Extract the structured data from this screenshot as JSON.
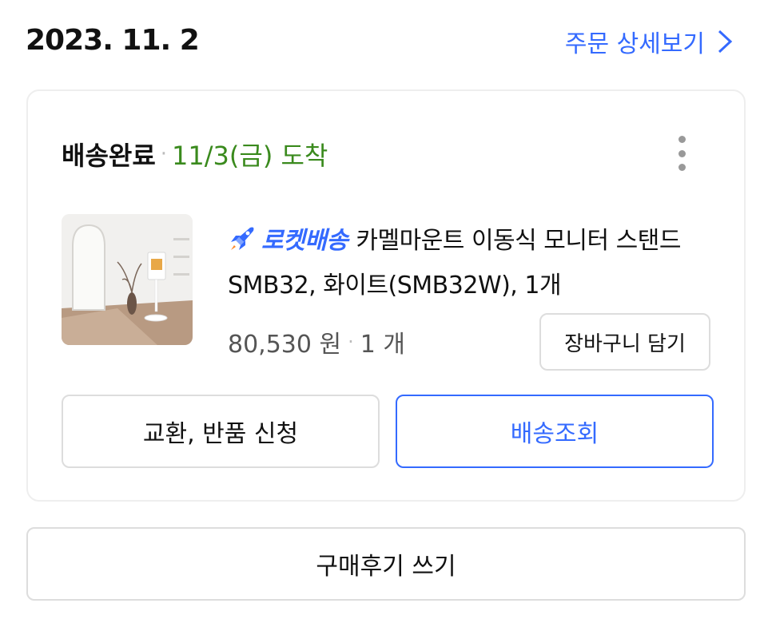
{
  "order": {
    "date": "2023. 11. 2",
    "detail_link_label": "주문 상세보기"
  },
  "shipment": {
    "status": "배송완료",
    "separator": "·",
    "arrival": "11/3(금) 도착"
  },
  "product": {
    "badge": "로켓배송",
    "name": "카멜마운트 이동식 모니터 스탠드 SMB32, 화이트(SMB32W), 1개",
    "price": "80,530 원",
    "quantity": "1 개",
    "cart_button": "장바구니 담기"
  },
  "actions": {
    "return_button": "교환, 반품 신청",
    "track_button": "배송조회",
    "review_button": "구매후기 쓰기"
  },
  "colors": {
    "accent": "#346aff",
    "delivered_green": "#3a8a1d",
    "border": "#dddddd"
  },
  "icons": [
    "chevron-right-icon",
    "more-vertical-icon",
    "rocket-icon"
  ]
}
